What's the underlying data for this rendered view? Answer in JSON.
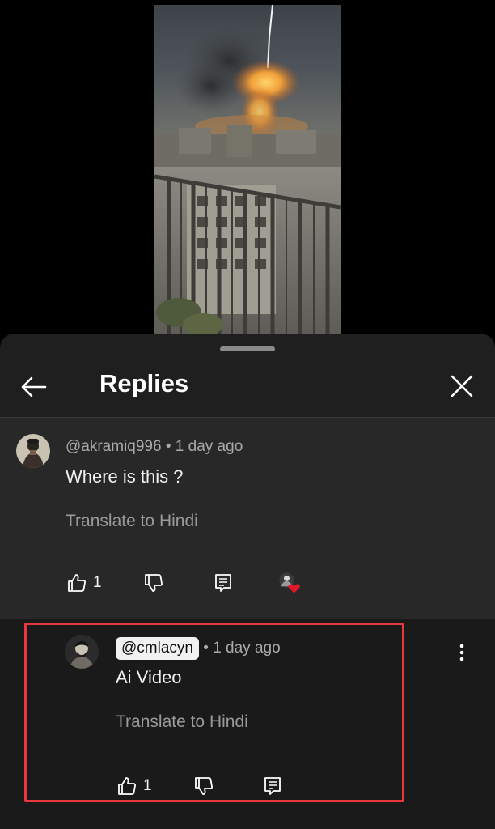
{
  "sheet": {
    "title": "Replies",
    "back_icon": "arrow-left-icon",
    "close_icon": "close-icon"
  },
  "parent_comment": {
    "author": "@akramiq996",
    "separator": "•",
    "time": "1 day ago",
    "text": "Where is this ?",
    "translate": "Translate to Hindi",
    "like_count": "1",
    "icons": [
      "thumbs-up-icon",
      "thumbs-down-icon",
      "reply-icon",
      "creator-heart-icon"
    ]
  },
  "reply": {
    "author": "@cmlacyn",
    "separator": "•",
    "time": "1 day ago",
    "text": "Ai Video",
    "translate": "Translate to Hindi",
    "like_count": "1",
    "icons": [
      "thumbs-up-icon",
      "thumbs-down-icon",
      "reply-icon",
      "more-vertical-icon"
    ]
  },
  "colors": {
    "highlight_border": "#e8383d",
    "heart": "#e3172a",
    "sheet_bg": "#1f1f1f",
    "parent_bg": "#282828"
  }
}
